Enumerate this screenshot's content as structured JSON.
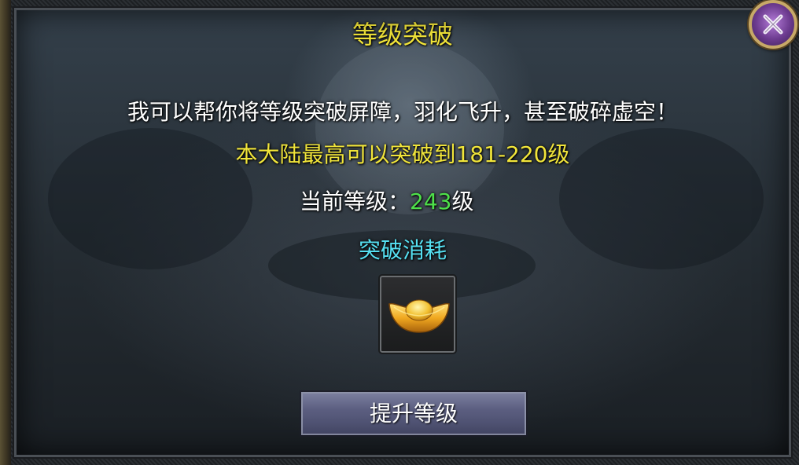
{
  "dialog": {
    "title": "等级突破",
    "description": "我可以帮你将等级突破屏障，羽化飞升，甚至破碎虚空！",
    "max_breakthrough": "本大陆最高可以突破到181-220级",
    "current_level_label": "当前等级：",
    "current_level_value": "243",
    "current_level_unit": "级",
    "cost_label": "突破消耗",
    "cost_item_icon": "gold-ingot-icon",
    "upgrade_button": "提升等级",
    "close_icon": "close-icon"
  },
  "colors": {
    "title": "#f3e63a",
    "highlight": "#f1e53a",
    "level_value": "#4ee04a",
    "cost_label": "#56e0f2",
    "button": "#5b5e80",
    "close_button": "#6b3a8e"
  }
}
